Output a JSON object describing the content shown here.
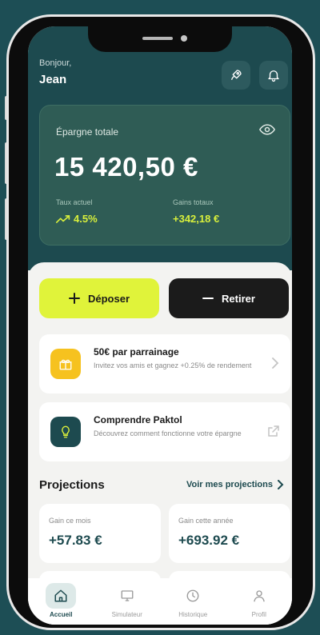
{
  "header": {
    "greeting": "Bonjour,",
    "user_name": "Jean",
    "icons": [
      "rocket-icon",
      "bell-icon"
    ]
  },
  "savings": {
    "label": "Épargne totale",
    "amount": "15 420,50 €",
    "rate_label": "Taux actuel",
    "rate_value": "4.5%",
    "gains_label": "Gains totaux",
    "gains_value": "+342,18 €",
    "visibility_icon": "eye-icon"
  },
  "actions": {
    "deposit_label": "Déposer",
    "withdraw_label": "Retirer"
  },
  "cards": [
    {
      "title": "50€ par parrainage",
      "subtitle": "Invitez vos amis et gagnez +0.25% de rendement",
      "icon": "gift-icon",
      "arrow": "chevron-right-icon"
    },
    {
      "title": "Comprendre Paktol",
      "subtitle": "Découvrez comment fonctionne votre épargne",
      "icon": "lightbulb-icon",
      "arrow": "external-link-icon"
    }
  ],
  "projections": {
    "title": "Projections",
    "link_label": "Voir mes projections",
    "items": [
      {
        "label": "Gain ce mois",
        "value": "+57.83 €"
      },
      {
        "label": "Gain cette année",
        "value": "+693.92 €"
      }
    ]
  },
  "nav": {
    "items": [
      {
        "label": "Accueil",
        "icon": "home-icon",
        "active": true
      },
      {
        "label": "Simulateur",
        "icon": "monitor-icon",
        "active": false
      },
      {
        "label": "Historique",
        "icon": "clock-icon",
        "active": false
      },
      {
        "label": "Profil",
        "icon": "user-icon",
        "active": false
      }
    ]
  },
  "colors": {
    "background": "#1d4e55",
    "brand_dark": "#1d4a4f",
    "accent_lime": "#e0f33a",
    "card_green": "#2f5c55",
    "gift_yellow": "#f6c21f"
  }
}
